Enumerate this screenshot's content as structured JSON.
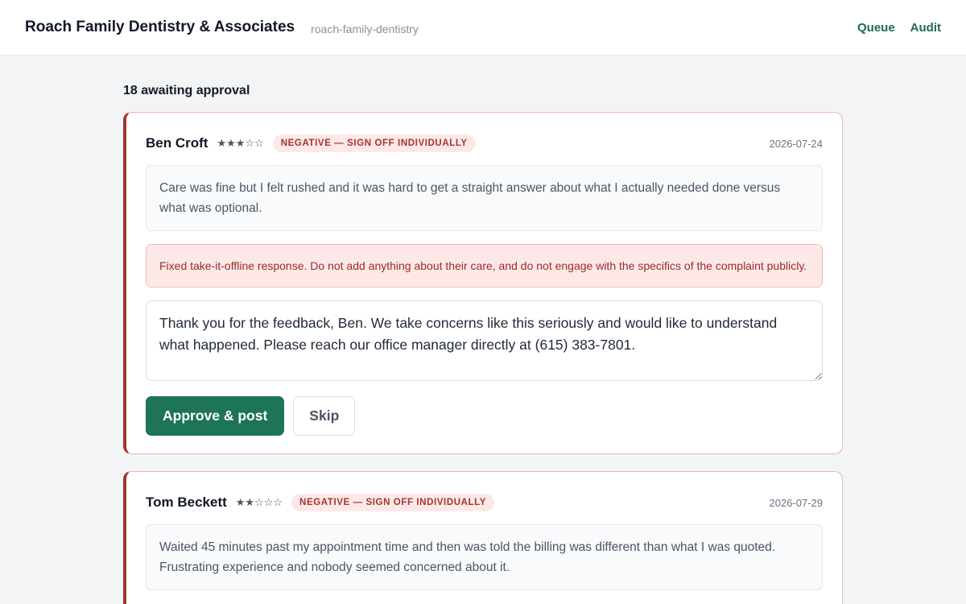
{
  "header": {
    "title": "Roach Family Dentistry & Associates",
    "slug": "roach-family-dentistry",
    "nav": [
      "Queue",
      "Audit"
    ]
  },
  "queue": {
    "count_label": "18 awaiting approval"
  },
  "colors": {
    "accent": "#1d7458",
    "negative": "#a23530",
    "negative_bg": "#fde8e8"
  },
  "reviews": [
    {
      "name": "Ben Croft",
      "stars": "★★★☆☆",
      "rating": 3,
      "badge": "NEGATIVE — SIGN OFF INDIVIDUALLY",
      "date": "2026-07-24",
      "text": "Care was fine but I felt rushed and it was hard to get a straight answer about what I actually needed done versus what was optional.",
      "policy": "Fixed take-it-offline response. Do not add anything about their care, and do not engage with the specifics of the complaint publicly.",
      "reply": "Thank you for the feedback, Ben. We take concerns like this seriously and would like to understand what happened. Please reach our office manager directly at (615) 383-7801.",
      "approve_label": "Approve & post",
      "skip_label": "Skip"
    },
    {
      "name": "Tom Beckett",
      "stars": "★★☆☆☆",
      "rating": 2,
      "badge": "NEGATIVE — SIGN OFF INDIVIDUALLY",
      "date": "2026-07-29",
      "text": "Waited 45 minutes past my appointment time and then was told the billing was different than what I was quoted. Frustrating experience and nobody seemed concerned about it."
    }
  ]
}
